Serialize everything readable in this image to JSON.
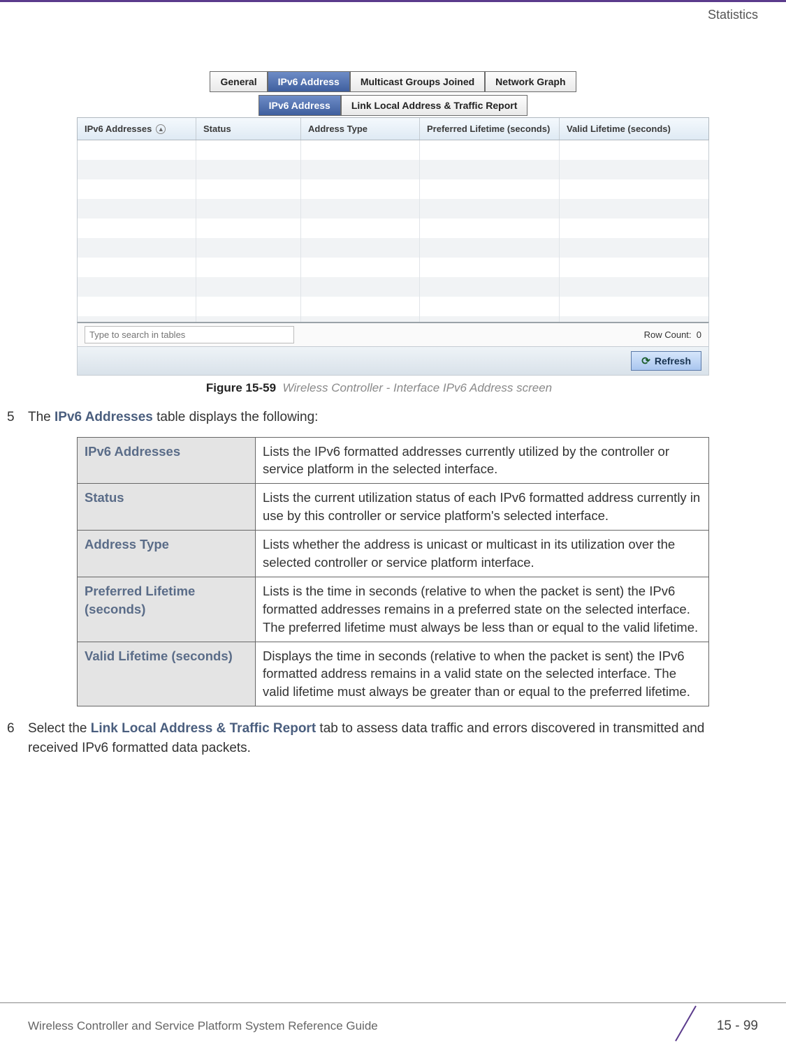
{
  "header": {
    "section": "Statistics"
  },
  "screenshot": {
    "tabs_row1": [
      {
        "label": "General",
        "active": false
      },
      {
        "label": "IPv6 Address",
        "active": true
      },
      {
        "label": "Multicast Groups Joined",
        "active": false
      },
      {
        "label": "Network Graph",
        "active": false
      }
    ],
    "tabs_row2": [
      {
        "label": "IPv6 Address",
        "active": true
      },
      {
        "label": "Link Local Address & Traffic Report",
        "active": false
      }
    ],
    "columns": {
      "addr": "IPv6 Addresses",
      "status": "Status",
      "type": "Address Type",
      "pref": "Preferred Lifetime (seconds)",
      "valid": "Valid Lifetime (seconds)"
    },
    "search_placeholder": "Type to search in tables",
    "rowcount_label": "Row Count:",
    "rowcount_value": "0",
    "refresh_label": "Refresh"
  },
  "figure": {
    "num": "Figure 15-59",
    "title": "Wireless Controller - Interface IPv6 Address screen"
  },
  "step5": {
    "num": "5",
    "pre": "The ",
    "kw": "IPv6 Addresses",
    "post": " table displays the following:"
  },
  "def_rows": [
    {
      "term": "IPv6 Addresses",
      "desc": "Lists the IPv6 formatted addresses currently utilized by the controller or service platform in the selected interface."
    },
    {
      "term": "Status",
      "desc": "Lists the current utilization status of each IPv6 formatted address currently in use by this controller or service platform's selected interface."
    },
    {
      "term": "Address Type",
      "desc": "Lists whether the address is unicast or multicast in its utilization over the selected controller or service platform interface."
    },
    {
      "term": "Preferred Lifetime (seconds)",
      "desc": "Lists is the time in seconds (relative to when the packet is sent) the IPv6 formatted addresses remains in a preferred state on the selected interface. The preferred lifetime must always be less than or equal to the valid lifetime."
    },
    {
      "term": "Valid Lifetime (seconds)",
      "desc": "Displays the time in seconds (relative to when the packet is sent) the IPv6 formatted address remains in a valid state on the selected interface. The valid lifetime must always be greater than or equal to the preferred lifetime."
    }
  ],
  "step6": {
    "num": "6",
    "pre": "Select the ",
    "kw": "Link Local Address & Traffic Report",
    "post": " tab to assess data traffic and errors discovered in transmitted and received IPv6 formatted data packets."
  },
  "footer": {
    "guide": "Wireless Controller and Service Platform System Reference Guide",
    "page": "15 - 99"
  }
}
